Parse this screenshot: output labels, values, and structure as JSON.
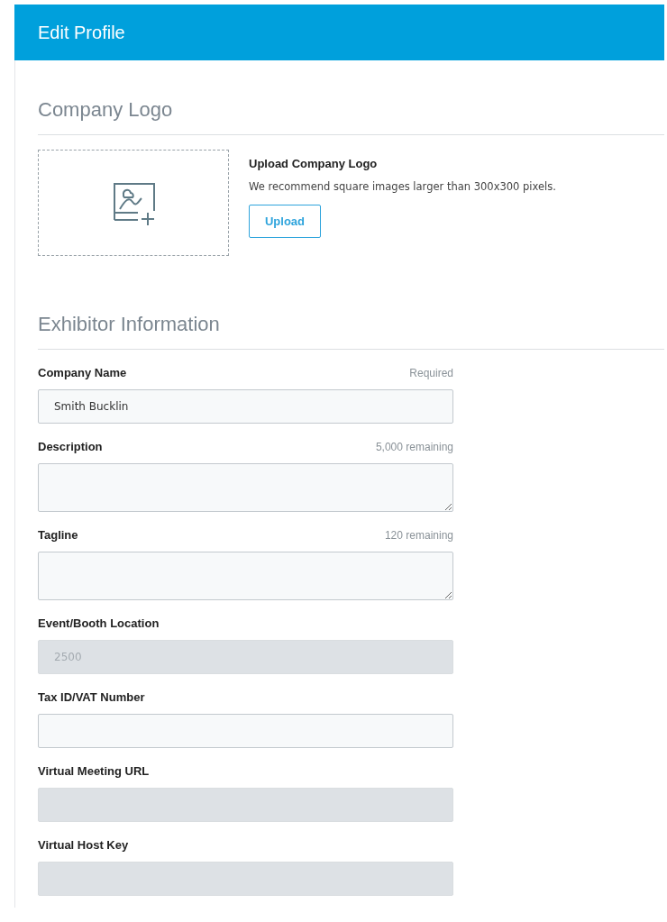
{
  "header": {
    "title": "Edit Profile"
  },
  "logo_section": {
    "heading": "Company Logo",
    "upload_title": "Upload Company Logo",
    "upload_hint": "We recommend square images larger than 300x300 pixels.",
    "upload_button": "Upload"
  },
  "exhibitor_section": {
    "heading": "Exhibitor Information",
    "fields": [
      {
        "label": "Company Name",
        "hint": "Required",
        "kind": "text",
        "value": "Smith Bucklin",
        "disabled": false
      },
      {
        "label": "Description",
        "hint": "5,000 remaining",
        "kind": "textarea",
        "disabled": false
      },
      {
        "label": "Tagline",
        "hint": "120 remaining",
        "kind": "textarea",
        "disabled": false
      },
      {
        "label": "Event/Booth Location",
        "kind": "text",
        "value": "2500",
        "disabled": true
      },
      {
        "label": "Tax ID/VAT Number",
        "kind": "text",
        "disabled": false
      },
      {
        "label": "Virtual Meeting URL",
        "kind": "text",
        "disabled": true
      },
      {
        "label": "Virtual Host Key",
        "kind": "text",
        "disabled": true
      }
    ]
  }
}
